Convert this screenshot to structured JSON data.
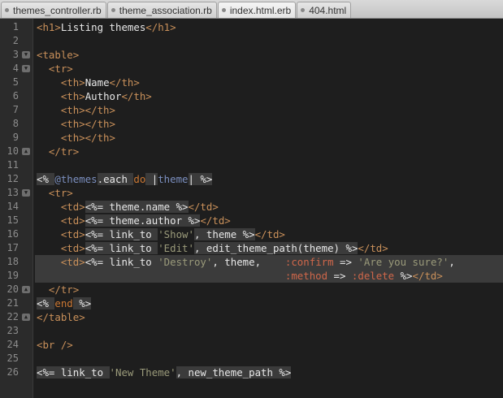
{
  "tabs": [
    {
      "label": "themes_controller.rb",
      "active": false
    },
    {
      "label": "theme_association.rb",
      "active": false
    },
    {
      "label": "index.html.erb",
      "active": true
    },
    {
      "label": "404.html",
      "active": false
    }
  ],
  "editor": {
    "lines": [
      {
        "n": "1",
        "fold": "",
        "hl": false,
        "tokens": [
          [
            "tag",
            "<h1>"
          ],
          [
            "text",
            "Listing themes"
          ],
          [
            "tag",
            "</h1>"
          ]
        ]
      },
      {
        "n": "2",
        "fold": "",
        "hl": false,
        "tokens": []
      },
      {
        "n": "3",
        "fold": "down",
        "hl": false,
        "tokens": [
          [
            "tag",
            "<table>"
          ]
        ]
      },
      {
        "n": "4",
        "fold": "down",
        "hl": false,
        "tokens": [
          [
            "text",
            "  "
          ],
          [
            "tag",
            "<tr>"
          ]
        ]
      },
      {
        "n": "5",
        "fold": "",
        "hl": false,
        "tokens": [
          [
            "text",
            "    "
          ],
          [
            "tag",
            "<th>"
          ],
          [
            "text",
            "Name"
          ],
          [
            "tag",
            "</th>"
          ]
        ]
      },
      {
        "n": "6",
        "fold": "",
        "hl": false,
        "tokens": [
          [
            "text",
            "    "
          ],
          [
            "tag",
            "<th>"
          ],
          [
            "text",
            "Author"
          ],
          [
            "tag",
            "</th>"
          ]
        ]
      },
      {
        "n": "7",
        "fold": "",
        "hl": false,
        "tokens": [
          [
            "text",
            "    "
          ],
          [
            "tag",
            "<th></th>"
          ]
        ]
      },
      {
        "n": "8",
        "fold": "",
        "hl": false,
        "tokens": [
          [
            "text",
            "    "
          ],
          [
            "tag",
            "<th></th>"
          ]
        ]
      },
      {
        "n": "9",
        "fold": "",
        "hl": false,
        "tokens": [
          [
            "text",
            "    "
          ],
          [
            "tag",
            "<th></th>"
          ]
        ]
      },
      {
        "n": "10",
        "fold": "up",
        "hl": false,
        "tokens": [
          [
            "text",
            "  "
          ],
          [
            "tag",
            "</tr>"
          ]
        ]
      },
      {
        "n": "11",
        "fold": "",
        "hl": false,
        "tokens": []
      },
      {
        "n": "12",
        "fold": "",
        "hl": false,
        "tokens": [
          [
            "erb",
            "<% "
          ],
          [
            "ivar",
            "@themes"
          ],
          [
            "erb",
            ".each "
          ],
          [
            "kw",
            "do"
          ],
          [
            "erb",
            " |"
          ],
          [
            "blk",
            "theme"
          ],
          [
            "erb",
            "| %>"
          ]
        ]
      },
      {
        "n": "13",
        "fold": "down",
        "hl": false,
        "tokens": [
          [
            "text",
            "  "
          ],
          [
            "tag",
            "<tr>"
          ]
        ]
      },
      {
        "n": "14",
        "fold": "",
        "hl": false,
        "tokens": [
          [
            "text",
            "    "
          ],
          [
            "tag",
            "<td>"
          ],
          [
            "erb",
            "<%= theme.name %>"
          ],
          [
            "tag",
            "</td>"
          ]
        ]
      },
      {
        "n": "15",
        "fold": "",
        "hl": false,
        "tokens": [
          [
            "text",
            "    "
          ],
          [
            "tag",
            "<td>"
          ],
          [
            "erb",
            "<%= theme.author %>"
          ],
          [
            "tag",
            "</td>"
          ]
        ]
      },
      {
        "n": "16",
        "fold": "",
        "hl": false,
        "tokens": [
          [
            "text",
            "    "
          ],
          [
            "tag",
            "<td>"
          ],
          [
            "erb",
            "<%= link_to "
          ],
          [
            "str",
            "'Show'"
          ],
          [
            "erb",
            ", theme %>"
          ],
          [
            "tag",
            "</td>"
          ]
        ]
      },
      {
        "n": "17",
        "fold": "",
        "hl": false,
        "tokens": [
          [
            "text",
            "    "
          ],
          [
            "tag",
            "<td>"
          ],
          [
            "erb",
            "<%= link_to "
          ],
          [
            "str",
            "'Edit'"
          ],
          [
            "erb",
            ", edit_theme_path(theme) %>"
          ],
          [
            "tag",
            "</td>"
          ]
        ]
      },
      {
        "n": "18",
        "fold": "",
        "hl": true,
        "tokens": [
          [
            "text",
            "    "
          ],
          [
            "tag",
            "<td>"
          ],
          [
            "erb",
            "<%= link_to "
          ],
          [
            "str",
            "'Destroy'"
          ],
          [
            "erb",
            ", theme,    "
          ],
          [
            "sym",
            ":confirm"
          ],
          [
            "erb",
            " => "
          ],
          [
            "str",
            "'Are you sure?'"
          ],
          [
            "erb",
            ","
          ]
        ]
      },
      {
        "n": "19",
        "fold": "",
        "hl": true,
        "tokens": [
          [
            "erb",
            "                                         "
          ],
          [
            "sym",
            ":method"
          ],
          [
            "erb",
            " => "
          ],
          [
            "sym",
            ":delete"
          ],
          [
            "erb",
            " %>"
          ],
          [
            "tag",
            "</td>"
          ]
        ]
      },
      {
        "n": "20",
        "fold": "up",
        "hl": false,
        "tokens": [
          [
            "text",
            "  "
          ],
          [
            "tag",
            "</tr>"
          ]
        ]
      },
      {
        "n": "21",
        "fold": "",
        "hl": false,
        "tokens": [
          [
            "erb",
            "<% "
          ],
          [
            "kw",
            "end"
          ],
          [
            "erb",
            " %>"
          ]
        ]
      },
      {
        "n": "22",
        "fold": "up",
        "hl": false,
        "tokens": [
          [
            "tag",
            "</table>"
          ]
        ]
      },
      {
        "n": "23",
        "fold": "",
        "hl": false,
        "tokens": []
      },
      {
        "n": "24",
        "fold": "",
        "hl": false,
        "tokens": [
          [
            "tag",
            "<br />"
          ]
        ]
      },
      {
        "n": "25",
        "fold": "",
        "hl": false,
        "tokens": []
      },
      {
        "n": "26",
        "fold": "",
        "hl": false,
        "tokens": [
          [
            "erb",
            "<%= link_to "
          ],
          [
            "str",
            "'New Theme'"
          ],
          [
            "erb",
            ", new_theme_path %>"
          ]
        ]
      }
    ]
  }
}
